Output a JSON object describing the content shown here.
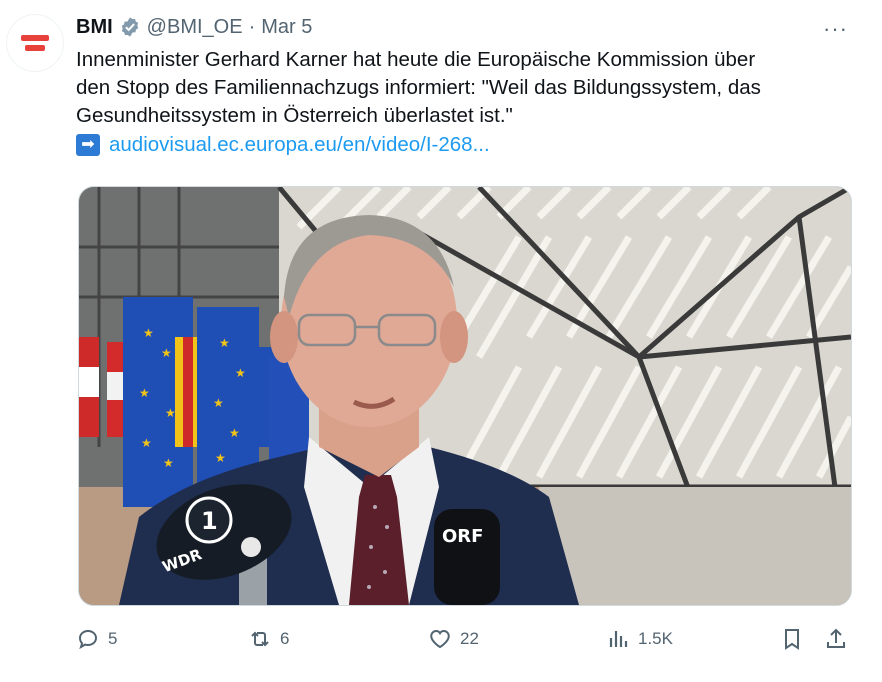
{
  "tweet": {
    "author_name": "BMI",
    "handle": "@BMI_OE",
    "separator": "·",
    "date": "Mar 5",
    "more_label": "···",
    "text_line1": "Innenminister Gerhard Karner hat heute die Europäische Kommission über",
    "text_line2": "den Stopp des Familiennachzugs informiert: \"Weil das Bildungssystem, das",
    "text_line3": "Gesundheitssystem in Österreich überlastet ist.\"",
    "link_text": "audiovisual.ec.europa.eu/en/video/I-268..."
  },
  "media": {
    "mic_left_label": "WDR",
    "mic_right_label": "ORF"
  },
  "actions": {
    "replies": "5",
    "reposts": "6",
    "likes": "22",
    "views": "1.5K"
  },
  "colors": {
    "accent": "#1d9bf0",
    "muted": "#536471",
    "verified": "#829aab",
    "logo_red": "#e8403a"
  }
}
